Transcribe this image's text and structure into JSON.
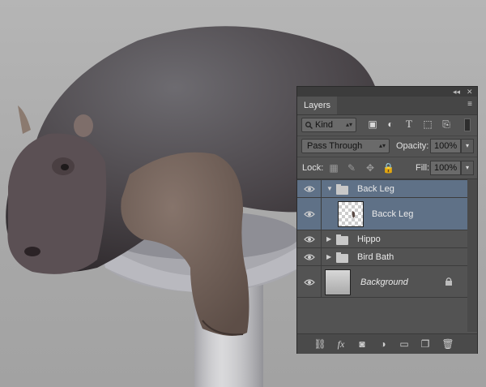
{
  "panel": {
    "title": "Layers",
    "collapse_glyph": "◂◂",
    "close_glyph": "✕",
    "menu_glyph": "≡",
    "filter": {
      "label": "Kind",
      "icon": "search-icon"
    },
    "blend_mode": "Pass Through",
    "opacity": {
      "label": "Opacity:",
      "value": "100%"
    },
    "lock": {
      "label": "Lock:"
    },
    "fill": {
      "label": "Fill:",
      "value": "100%"
    }
  },
  "layers": [
    {
      "name": "Back Leg",
      "type": "group",
      "expanded": true,
      "selected": true
    },
    {
      "name": "Bacck Leg",
      "type": "pixel",
      "selected": true
    },
    {
      "name": "Hippo",
      "type": "group",
      "expanded": false,
      "selected": false
    },
    {
      "name": "Bird Bath",
      "type": "group",
      "expanded": false,
      "selected": false
    },
    {
      "name": "Background",
      "type": "background",
      "locked": true,
      "selected": false
    }
  ],
  "colors": {
    "panel_bg": "#535353",
    "selection": "#5f7187",
    "canvas_bg": "#a9a9a9"
  }
}
